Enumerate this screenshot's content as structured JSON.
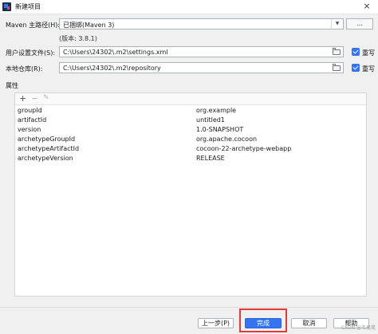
{
  "window": {
    "title": "新建项目",
    "close_glyph": "×"
  },
  "maven_home": {
    "label": "Maven 主路径(H):",
    "value": "已捆绑(Maven 3)",
    "version": "(版本: 3.8.1)",
    "browse_label": "..."
  },
  "user_settings": {
    "label": "用户设置文件(S):",
    "value": "C:\\Users\\24302\\.m2\\settings.xml",
    "override_label": "重写",
    "override_checked": true
  },
  "local_repo": {
    "label": "本地仓库(R):",
    "value": "C:\\Users\\24302\\.m2\\repository",
    "override_label": "重写",
    "override_checked": true
  },
  "properties": {
    "section_label": "属性",
    "toolbar": {
      "add": "+",
      "remove": "−",
      "edit": "✎"
    },
    "rows": [
      {
        "key": "groupId",
        "value": "org.example"
      },
      {
        "key": "artifactId",
        "value": "untitled1"
      },
      {
        "key": "version",
        "value": "1.0-SNAPSHOT"
      },
      {
        "key": "archetypeGroupId",
        "value": "org.apache.cocoon"
      },
      {
        "key": "archetypeArtifactId",
        "value": "cocoon-22-archetype-webapp"
      },
      {
        "key": "archetypeVersion",
        "value": "RELEASE"
      }
    ]
  },
  "buttons": {
    "previous": "上一步(P)",
    "finish": "完成",
    "cancel": "取消",
    "help": "帮助"
  },
  "watermark": "CSDN @韦易笑",
  "colors": {
    "accent": "#3574f0",
    "highlight": "#e03a3a"
  }
}
